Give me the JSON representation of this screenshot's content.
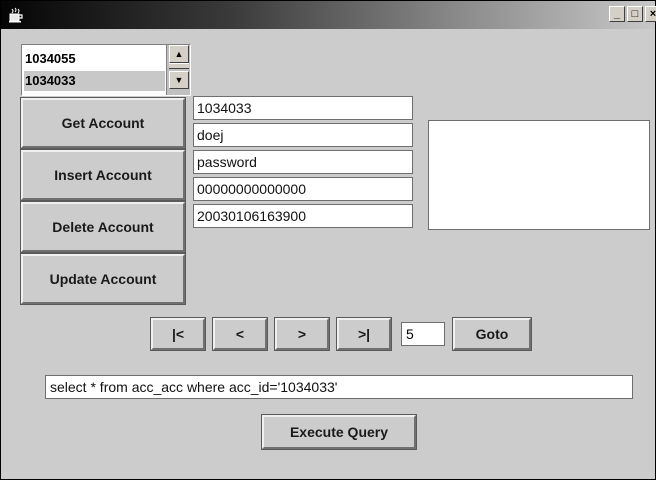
{
  "window": {
    "icon": "java-coffee-cup-icon",
    "controls": {
      "minimize": "_",
      "maximize": "□",
      "close": "×"
    }
  },
  "account_list": {
    "items": [
      "1034055",
      "1034033"
    ],
    "selected_index": 1,
    "scroll_up": "▲",
    "scroll_down": "▼"
  },
  "actions": {
    "get": "Get Account",
    "insert": "Insert Account",
    "delete": "Delete Account",
    "update": "Update Account"
  },
  "fields": {
    "account_id": "1034033",
    "username": "doej",
    "password": "password",
    "number": "00000000000000",
    "timestamp": "20030106163900"
  },
  "notes": "",
  "navigation": {
    "first": "|<",
    "prev": "<",
    "next": ">",
    "last": ">|",
    "page": "5",
    "goto": "Goto"
  },
  "query": {
    "text": "select * from acc_acc where acc_id='1034033'",
    "execute": "Execute Query"
  }
}
